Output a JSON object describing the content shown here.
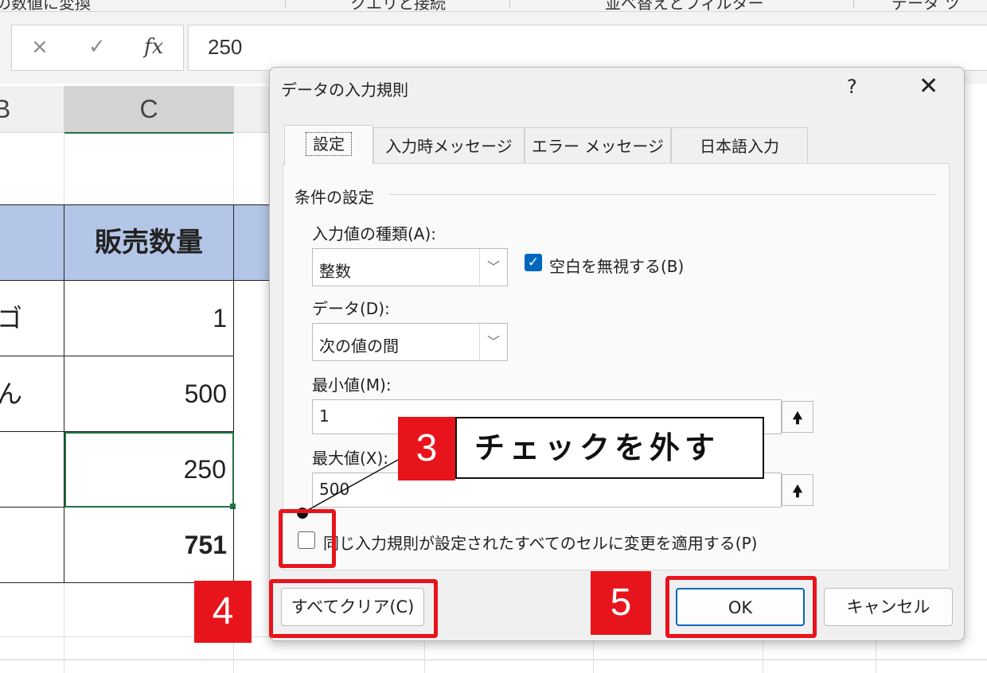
{
  "ribbon": {
    "items": [
      "の数値に変換",
      "クエリと接続",
      "並べ替えとフィルター",
      "データ ツ"
    ]
  },
  "formula_bar": {
    "cancel_icon": "×",
    "enter_icon": "✓",
    "fx_icon": "fx",
    "value": "250"
  },
  "sheet": {
    "col_b": "B",
    "col_c": "C",
    "header": "販売数量",
    "rows": [
      {
        "b": "ゴ",
        "c": "1"
      },
      {
        "b": "ん",
        "c": "500"
      },
      {
        "b": "",
        "c": "250"
      },
      {
        "b": "",
        "c": "751"
      }
    ]
  },
  "dialog": {
    "title": "データの入力規則",
    "help": "?",
    "close": "✕",
    "tabs": [
      "設定",
      "入力時メッセージ",
      "エラー メッセージ",
      "日本語入力"
    ],
    "section_label": "条件の設定",
    "allow_label": "入力値の種類(A):",
    "allow_value": "整数",
    "ignore_blank_label": "空白を無視する(B)",
    "ignore_blank_checked": true,
    "data_label": "データ(D):",
    "data_value": "次の値の間",
    "min_label": "最小値(M):",
    "min_value": "1",
    "max_label": "最大値(X):",
    "max_value": "500",
    "apply_all_label": "同じ入力規則が設定されたすべてのセルに変更を適用する(P)",
    "apply_all_checked": false,
    "clear_button": "すべてクリア(C)",
    "ok_button": "OK",
    "cancel_button": "キャンセル"
  },
  "annotations": {
    "step3_number": "3",
    "step3_text": "チェックを外す",
    "step4_number": "4",
    "step5_number": "5",
    "highlight_color": "#e8141b"
  }
}
